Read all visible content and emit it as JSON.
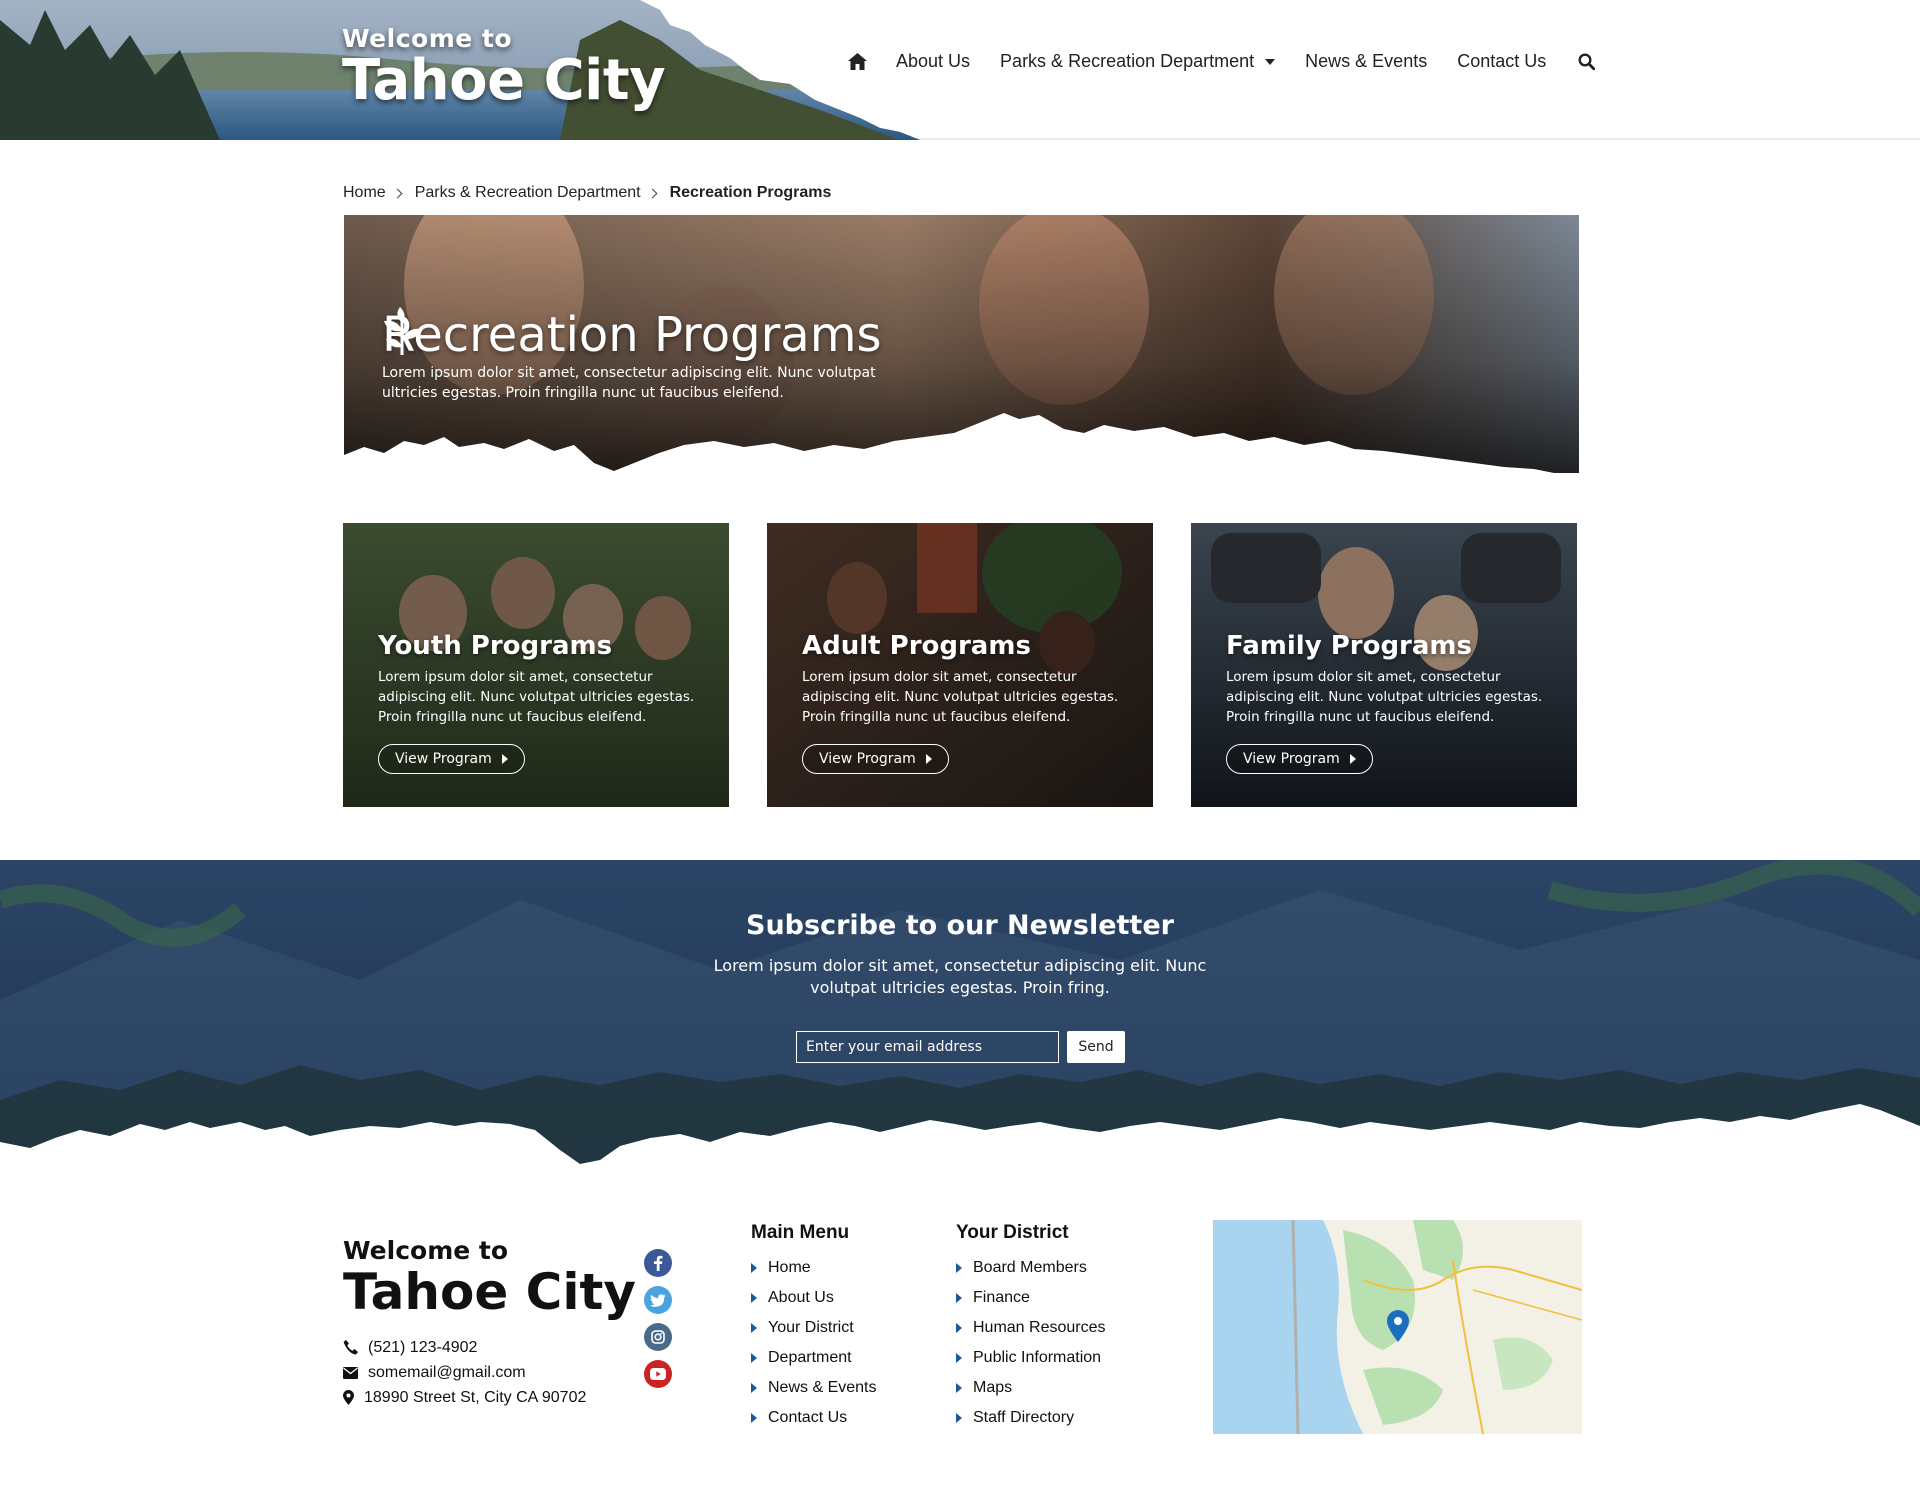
{
  "brand": {
    "welcome": "Welcome to",
    "city": "Tahoe City"
  },
  "nav": {
    "home_icon": "home-icon",
    "items": [
      "About Us",
      "Parks & Recreation Department",
      "News & Events",
      "Contact Us"
    ],
    "search_icon": "search-icon"
  },
  "breadcrumb": [
    "Home",
    "Parks & Recreation Department",
    "Recreation Programs"
  ],
  "hero": {
    "icon": "leaf-icon",
    "title": "Recreation Programs",
    "description": "Lorem ipsum dolor sit amet, consectetur adipiscing elit. Nunc volutpat ultricies egestas. Proin fringilla nunc ut faucibus eleifend."
  },
  "cards": [
    {
      "title": "Youth Programs",
      "description": "Lorem ipsum dolor sit amet, consectetur adipiscing elit. Nunc volutpat ultricies egestas. Proin fringilla nunc ut faucibus eleifend.",
      "button": "View Program"
    },
    {
      "title": "Adult Programs",
      "description": "Lorem ipsum dolor sit amet, consectetur adipiscing elit. Nunc volutpat ultricies egestas. Proin fringilla nunc ut faucibus eleifend.",
      "button": "View Program"
    },
    {
      "title": "Family Programs",
      "description": "Lorem ipsum dolor sit amet, consectetur adipiscing elit. Nunc volutpat ultricies egestas. Proin fringilla nunc ut faucibus eleifend.",
      "button": "View Program"
    }
  ],
  "newsletter": {
    "title": "Subscribe to our Newsletter",
    "description": "Lorem ipsum dolor sit amet, consectetur adipiscing elit. Nunc volutpat ultricies egestas. Proin fring.",
    "placeholder": "Enter your email address",
    "button": "Send"
  },
  "footer": {
    "welcome": "Welcome to",
    "city": "Tahoe City",
    "phone": "(521) 123-4902",
    "email": "somemail@gmail.com",
    "address": "18990 Street St, City CA 90702",
    "socials": [
      {
        "icon": "facebook-icon",
        "color": "#3b5998"
      },
      {
        "icon": "twitter-icon",
        "color": "#4aa3df"
      },
      {
        "icon": "instagram-icon",
        "color": "#4a6a8a"
      },
      {
        "icon": "youtube-icon",
        "color": "#cc2222"
      }
    ],
    "main_menu": {
      "title": "Main Menu",
      "items": [
        "Home",
        "About Us",
        "Your District",
        "Department",
        "News & Events",
        "Contact Us"
      ]
    },
    "district_menu": {
      "title": "Your District",
      "items": [
        "Board Members",
        "Finance",
        "Human Resources",
        "Public Information",
        "Maps",
        "Staff Directory"
      ]
    }
  },
  "colors": {
    "navy": "#1e3656",
    "accent": "#1a5a9a",
    "lake": "#a9d4ef",
    "land": "#f3f0e6"
  }
}
